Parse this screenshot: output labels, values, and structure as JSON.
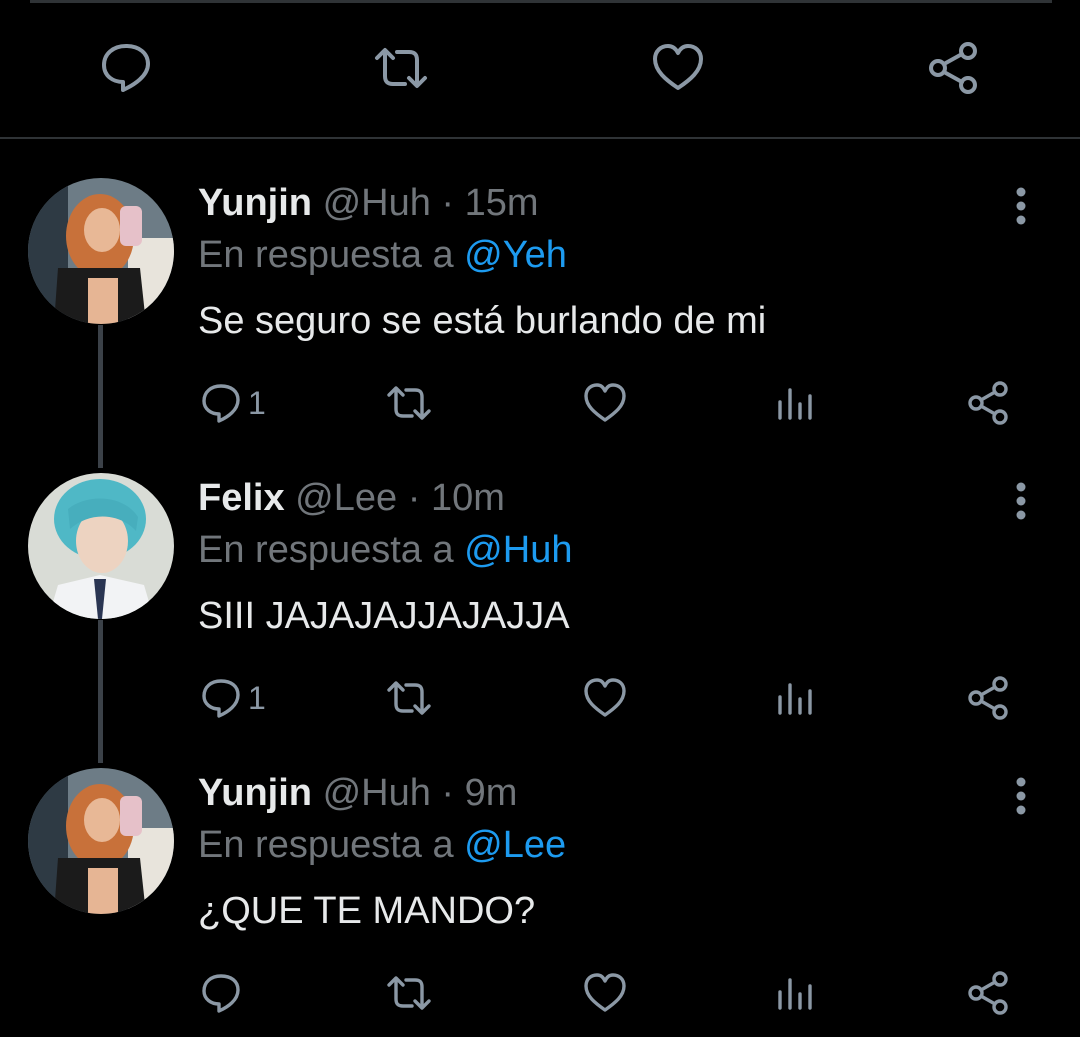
{
  "top_actions": {
    "reply_icon": "reply-icon",
    "retweet_icon": "retweet-icon",
    "like_icon": "heart-icon",
    "share_icon": "share-icon"
  },
  "tweets": [
    {
      "name": "Yunjin",
      "handle": "@Huh",
      "dot": "·",
      "time": "15m",
      "reply_prefix": "En respuesta a",
      "reply_to": "@Yeh",
      "text": "Se seguro se está burlando de mi",
      "reply_count": "1",
      "avatar": "avatar-yunjin"
    },
    {
      "name": "Felix",
      "handle": "@Lee",
      "dot": "·",
      "time": "10m",
      "reply_prefix": "En respuesta a",
      "reply_to": "@Huh",
      "text": "SIII JAJAJAJJAJAJJA",
      "reply_count": "1",
      "avatar": "avatar-felix"
    },
    {
      "name": "Yunjin",
      "handle": "@Huh",
      "dot": "·",
      "time": "9m",
      "reply_prefix": "En respuesta a",
      "reply_to": "@Lee",
      "text": "¿QUE TE MANDO?",
      "reply_count": "",
      "avatar": "avatar-yunjin"
    }
  ],
  "colors": {
    "background": "#000000",
    "text": "#e7e9ea",
    "muted": "#71767b",
    "link": "#1d9bf0",
    "icon": "#8b98a5",
    "thread_line": "#3b4148"
  }
}
